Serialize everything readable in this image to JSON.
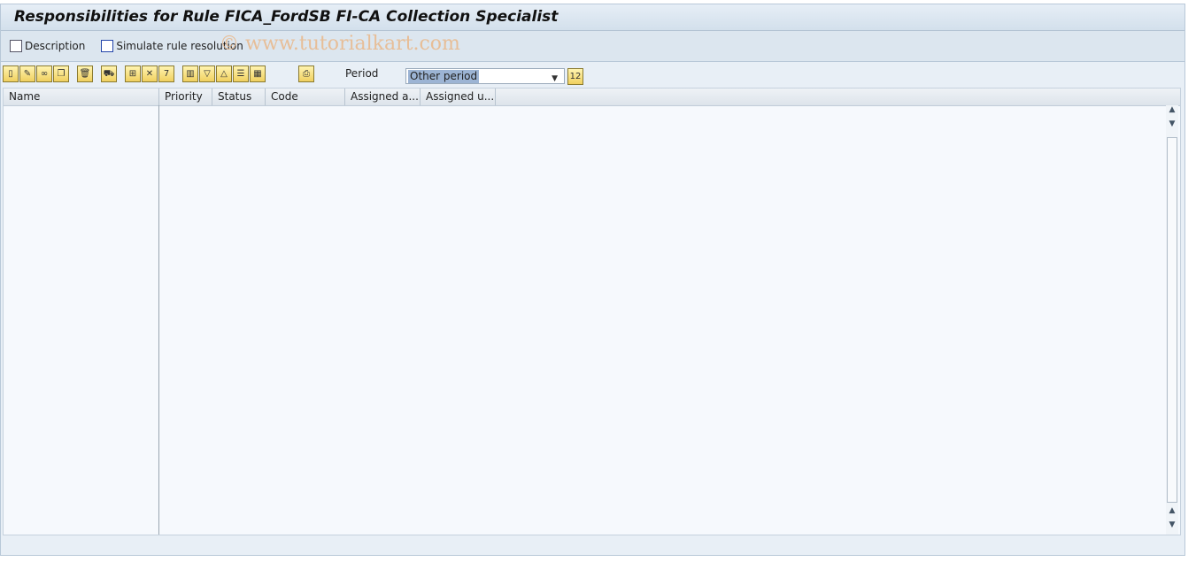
{
  "title": "Responsibilities for Rule FICA_FordSB FI-CA Collection Specialist",
  "appbar": {
    "description": "Description",
    "simulate": "Simulate rule resolution"
  },
  "watermark": "© www.tutorialkart.com",
  "toolbar": {
    "period_label": "Period",
    "period_value": "Other period"
  },
  "columns": [
    "Name",
    "Priority",
    "Status",
    "Code",
    "Assigned a...",
    "Assigned u..."
  ]
}
